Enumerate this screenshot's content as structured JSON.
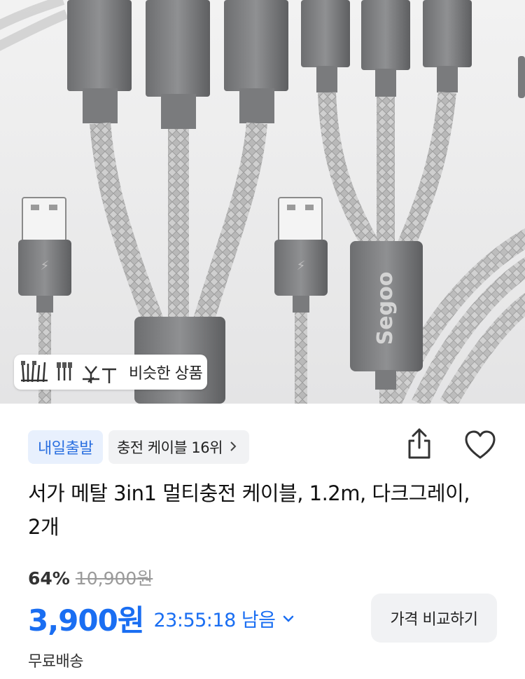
{
  "product_image": {
    "alt": "3-in-1 braided charging cable product photo",
    "brand_print": "Segoo"
  },
  "similar_products": {
    "label": "비슷한 상품"
  },
  "badges": {
    "delivery": "내일출발",
    "rank": "충전 케이블 16위"
  },
  "actions": {
    "share_icon": "share-icon",
    "wishlist_icon": "heart-icon"
  },
  "product": {
    "title": "서가 메탈 3in1 멀티충전 케이블, 1.2m, 다크그레이, 2개",
    "discount": "64%",
    "original_price": "10,900원",
    "price": "3,900원",
    "timer": "23:55:18 남음",
    "compare_label": "가격 비교하기",
    "shipping": "무료배송"
  },
  "colors": {
    "accent_blue": "#1a6ef2",
    "badge_blue_bg": "#e8f0fd",
    "gray_button": "#f1f2f4"
  }
}
